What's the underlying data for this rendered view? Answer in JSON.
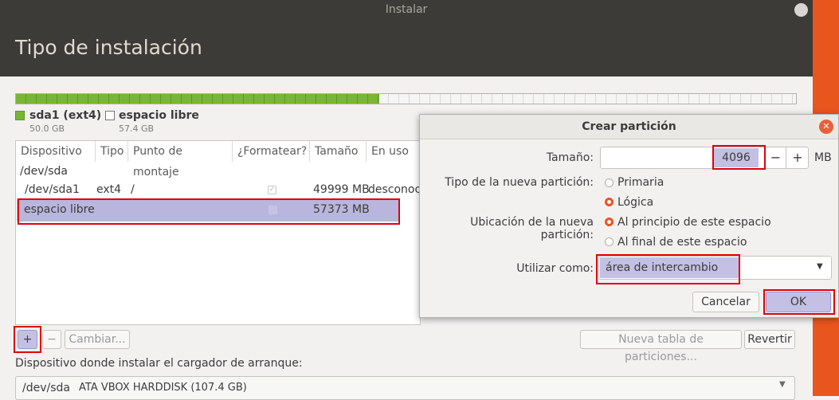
{
  "window": {
    "title": "Instalar"
  },
  "header": {
    "title": "Tipo de instalación"
  },
  "legend": [
    {
      "name": "sda1 (ext4)",
      "size": "50.0 GB",
      "color": "#7ab636"
    },
    {
      "name": "espacio libre",
      "size": "57.4 GB",
      "color": "#ffffff"
    }
  ],
  "disk_usage": {
    "used_fraction": 0.466
  },
  "table": {
    "columns": [
      "Dispositivo",
      "Tipo",
      "Punto de montaje",
      "¿Formatear?",
      "Tamaño",
      "En uso"
    ],
    "device": "/dev/sda",
    "rows": [
      {
        "device": "/dev/sda1",
        "type": "ext4",
        "mount": "/",
        "format": true,
        "size": "49999 MB",
        "used": "desconoc"
      },
      {
        "device": "espacio libre",
        "type": "",
        "mount": "",
        "format": false,
        "size": "57373 MB",
        "used": ""
      }
    ]
  },
  "buttons": {
    "add": "+",
    "remove": "−",
    "change": "Cambiar...",
    "new_table": "Nueva tabla de particiones...",
    "revert": "Revertir"
  },
  "bootloader": {
    "label": "Dispositivo donde instalar el cargador de arranque:",
    "device": "/dev/sda",
    "description": "ATA VBOX HARDDISK (107.4 GB)"
  },
  "dialog": {
    "title": "Crear partición",
    "size_label": "Tamaño:",
    "size_value": "4096",
    "size_unit": "MB",
    "minus": "−",
    "plus": "+",
    "type_label": "Tipo de la nueva partición:",
    "type_options": [
      "Primaria",
      "Lógica"
    ],
    "type_selected": "Lógica",
    "location_label": "Ubicación de la nueva partición:",
    "location_options": [
      "Al principio de este espacio",
      "Al final de este espacio"
    ],
    "location_selected": "Al principio de este espacio",
    "use_label": "Utilizar como:",
    "use_value": "área de intercambio",
    "cancel": "Cancelar",
    "ok": "OK"
  }
}
